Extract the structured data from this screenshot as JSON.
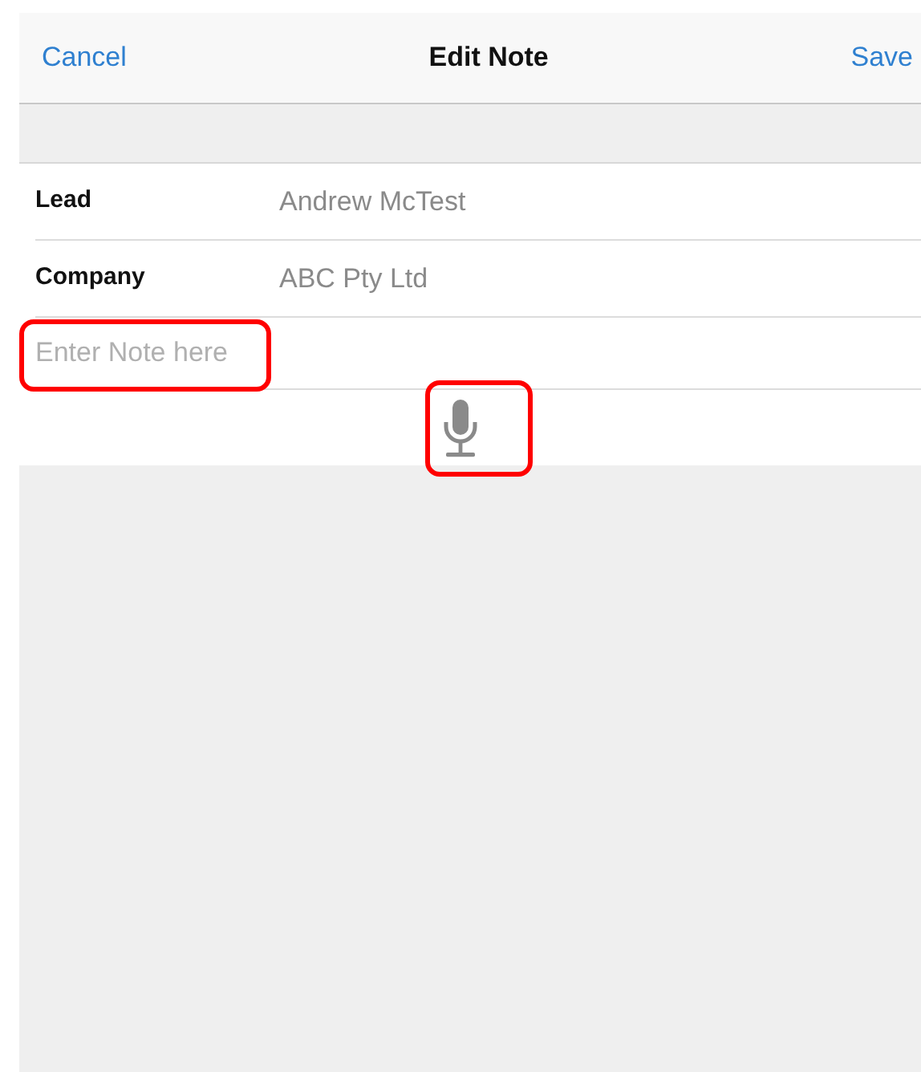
{
  "nav_bar": {
    "left_button": "Cancel",
    "title": "Edit Note",
    "right_button": "Save"
  },
  "fields": [
    {
      "label": "Lead",
      "value": "Andrew McTest"
    },
    {
      "label": "Company",
      "value": "ABC Pty Ltd"
    }
  ],
  "note": {
    "placeholder": "Enter Note here",
    "highlighted": true
  },
  "microphone": {
    "highlighted": true
  }
}
